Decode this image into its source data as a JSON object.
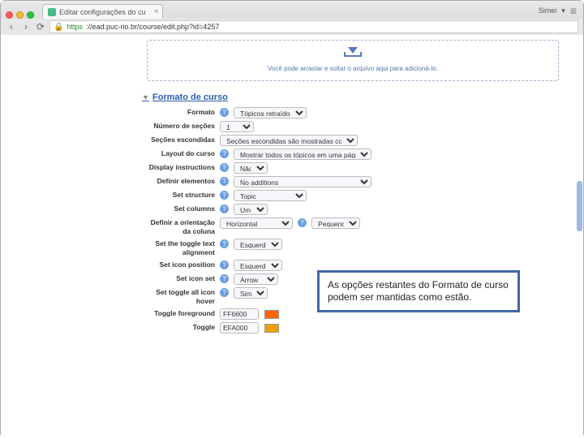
{
  "browser": {
    "tab_title": "Editar configurações do cu",
    "url_secure_prefix": "https",
    "url_rest": "://ead.puc-rio.br/course/edit.php?id=4257",
    "right_label": "Simei",
    "nav": {
      "back": "‹",
      "forward": "›",
      "reload": "⟳"
    }
  },
  "dropzone": {
    "text": "Você pode arrastar e soltar o arquivo aqui para adicioná-lo."
  },
  "section": {
    "title": "Formato de curso"
  },
  "fields": {
    "formato": {
      "label": "Formato",
      "value": "Tópicos retraídos"
    },
    "numero_secoes": {
      "label": "Número de seções",
      "value": "1"
    },
    "secoes_escondidas": {
      "label": "Seções escondidas",
      "value": "Seções escondidas são mostradas contraídas"
    },
    "layout_curso": {
      "label": "Layout do curso",
      "value": "Mostrar todos os tópicos em uma página"
    },
    "display_instructions": {
      "label": "Display instructions",
      "value": "Não"
    },
    "definir_elementos": {
      "label": "Definir elementos",
      "value": "No additions"
    },
    "set_structure": {
      "label": "Set structure",
      "value": "Topic"
    },
    "set_columns": {
      "label": "Set columns",
      "note_value": "Um",
      "value": "Um"
    },
    "definir_orientacao": {
      "label": "Definir a orientação da coluna",
      "value": "Horizontal"
    },
    "toggle_alignment": {
      "label": "Set the toggle text alignment",
      "value": "Esquerda"
    },
    "icon_position": {
      "label": "Set icon position",
      "value": "Esquerda"
    },
    "icon_set": {
      "label": "Set icon set",
      "value": "Arrow"
    },
    "toggle_all_hover": {
      "label": "Set toggle all icon hover",
      "value": "Sim"
    },
    "toggle_fg": {
      "label": "Toggle foreground",
      "value": "FF6600",
      "swatch": "#FF6600"
    },
    "toggle_bg": {
      "label": "Toggle",
      "value": "EFA000",
      "swatch": "#EFA000"
    }
  },
  "callout": {
    "text": "As opções restantes do Formato de curso podem ser mantidas como estão."
  }
}
